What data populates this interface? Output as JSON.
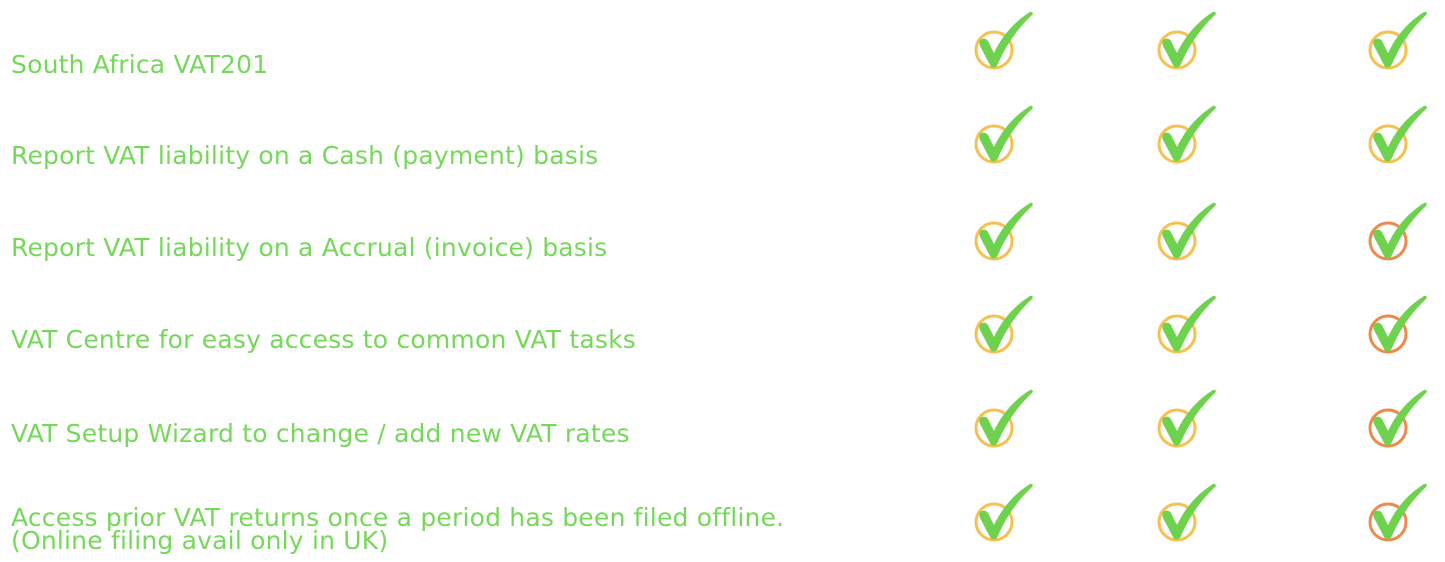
{
  "colors": {
    "label_text": "#76d85a",
    "check_fill": "#6fd24e",
    "ring_yellow": "#f7c04f",
    "ring_orange": "#f08a4b"
  },
  "rows": [
    {
      "label": "South Africa VAT201",
      "rings": [
        "yellow",
        "yellow",
        "yellow"
      ]
    },
    {
      "label": "Report VAT liability on a Cash (payment) basis",
      "rings": [
        "yellow",
        "yellow",
        "yellow"
      ]
    },
    {
      "label": "Report VAT liability on a Accrual (invoice) basis",
      "rings": [
        "yellow",
        "yellow",
        "orange"
      ]
    },
    {
      "label": "VAT Centre for easy access to common VAT tasks",
      "rings": [
        "yellow",
        "yellow",
        "orange"
      ]
    },
    {
      "label": "VAT Setup Wizard to change / add new VAT rates",
      "rings": [
        "yellow",
        "yellow",
        "orange"
      ]
    },
    {
      "label_lines": [
        "Access prior VAT returns once a period has been filed offline.",
        "(Online filing avail only in UK)"
      ],
      "rings": [
        "yellow",
        "yellow",
        "orange"
      ]
    }
  ]
}
